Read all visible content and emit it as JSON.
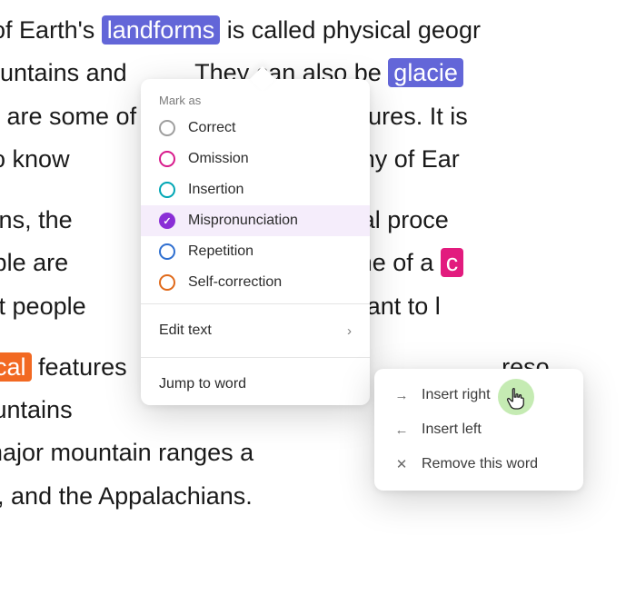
{
  "text": {
    "line1_a": "udy of Earth's ",
    "hl_landforms": "landforms",
    "line1_b": " is called physical geogr",
    "line2_a": "e mountains and          They can also be ",
    "hl_glacie": "glacie",
    "line3": "orms are some of              physical features. It is",
    "line4": "nts to know                        cal geography of Ear",
    "line5_a": "easons, the                      all ",
    "hl_the": "the",
    "line5_b": " natural proce",
    "line6_a": " people are                         graphy is one of a ",
    "hl_c": "c",
    "line7": "s that people                    where they want to l",
    "line8_a": "hysical",
    "line8_b": " features                                                       reso",
    "line9": ", mountains                                                         for s",
    "line10": "S., major mountain ranges a                            vada",
    "line11": "tains, and the Appalachians."
  },
  "popover": {
    "section_label": "Mark as",
    "items": [
      {
        "label": "Correct",
        "ring": "#9e9e9e",
        "selected": false
      },
      {
        "label": "Omission",
        "ring": "#d81b8c",
        "selected": false
      },
      {
        "label": "Insertion",
        "ring": "#00a6b4",
        "selected": false
      },
      {
        "label": "Mispronunciation",
        "ring": "#8a2ed6",
        "selected": true
      },
      {
        "label": "Repetition",
        "ring": "#2f6fd0",
        "selected": false
      },
      {
        "label": "Self-correction",
        "ring": "#e06a1b",
        "selected": false
      }
    ],
    "edit_text": "Edit text",
    "jump": "Jump to word"
  },
  "submenu": {
    "insert_right": "Insert right",
    "insert_left": "Insert left",
    "remove": "Remove this word"
  }
}
